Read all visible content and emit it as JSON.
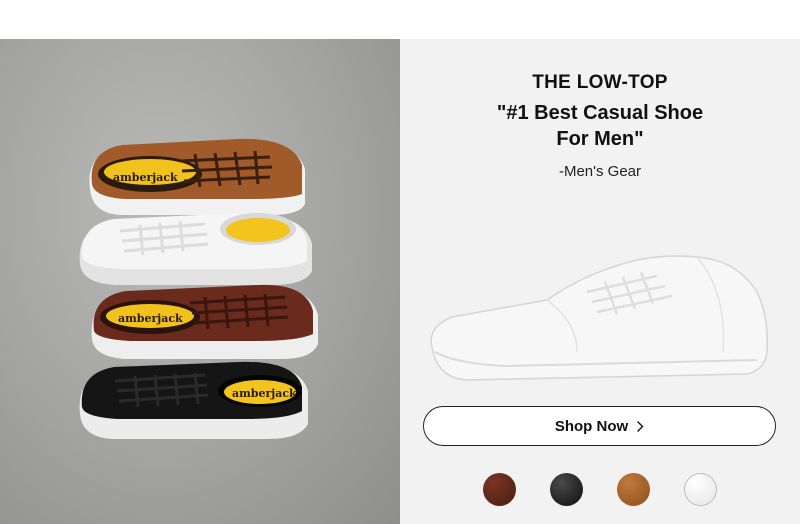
{
  "promo": {
    "eyebrow": "THE LOW-TOP",
    "headline_line1": "\"#1 Best Casual Shoe",
    "headline_line2": "For Men\"",
    "attribution": "-Men's Gear",
    "shop_label": "Shop Now"
  },
  "lifestyle_image": {
    "insole_brand": "amberjack"
  },
  "swatches": [
    {
      "name": "dark brown",
      "color": "#5a2419"
    },
    {
      "name": "black",
      "color": "#1a1a1a"
    },
    {
      "name": "cognac",
      "color": "#a2602c"
    },
    {
      "name": "white",
      "color": "#f4f4f4"
    }
  ],
  "colors": {
    "right_panel_bg": "#f2f2f2",
    "left_panel_bg": "#a3a3a1",
    "cognac_leather": "#a15a2a",
    "dark_brown_leather": "#6a2a1c",
    "black_leather": "#151515",
    "white_leather": "#f3f3f3",
    "insole_yellow": "#f2c21c"
  }
}
